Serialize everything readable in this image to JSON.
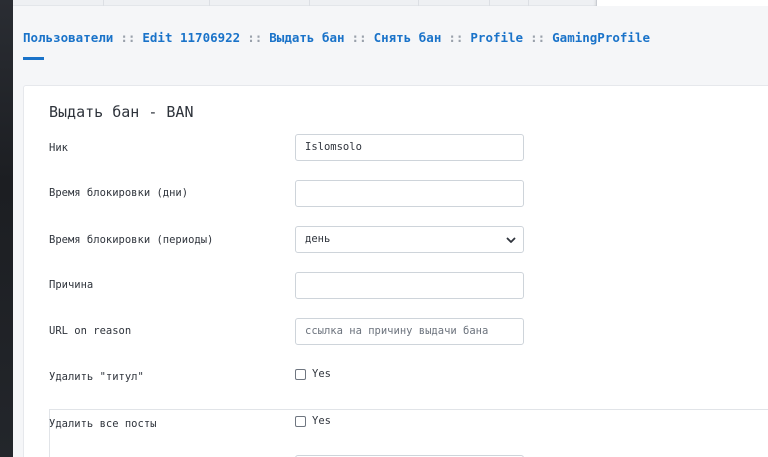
{
  "breadcrumb": [
    {
      "label": "Пользователи"
    },
    {
      "label": "Edit 11706922"
    },
    {
      "label": "Выдать бан"
    },
    {
      "label": "Снять бан"
    },
    {
      "label": "Profile"
    },
    {
      "label": "GamingProfile"
    }
  ],
  "separator": "::",
  "form": {
    "title": "Выдать бан - BAN",
    "nick": {
      "label": "Ник",
      "value": "Islomsolo"
    },
    "days": {
      "label": "Время блокировки (дни)",
      "value": ""
    },
    "period": {
      "label": "Время блокировки (периоды)",
      "value": "день"
    },
    "reason": {
      "label": "Причина",
      "value": ""
    },
    "url": {
      "label": "URL on reason",
      "placeholder": "ссылка на причину выдачи бана"
    },
    "remove_title": {
      "label": "Удалить \"титул\"",
      "option": "Yes"
    },
    "remove_posts": {
      "label": "Удалить все посты",
      "option": "Yes"
    }
  },
  "colors": {
    "accent": "#1a73c9"
  }
}
